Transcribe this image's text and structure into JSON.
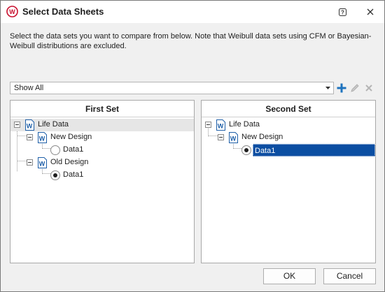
{
  "dialog": {
    "title": "Select Data Sheets",
    "instructions": "Select the data sets you want to compare from below. Note that Weibull data sets using CFM or Bayesian-Weibull distributions are excluded."
  },
  "filter": {
    "selected": "Show All"
  },
  "first_set": {
    "header": "First Set",
    "root": "Life Data",
    "groups": [
      {
        "name": "New Design",
        "item": "Data1",
        "checked": false
      },
      {
        "name": "Old Design",
        "item": "Data1",
        "checked": true
      }
    ]
  },
  "second_set": {
    "header": "Second Set",
    "root": "Life Data",
    "groups": [
      {
        "name": "New Design",
        "item": "Data1",
        "checked": true,
        "selected": true
      }
    ]
  },
  "buttons": {
    "ok": "OK",
    "cancel": "Cancel"
  },
  "colors": {
    "accent": "#0b4ea2",
    "app_icon": "#c8102e",
    "add_icon": "#1e73be"
  },
  "icons": [
    "app-logo-icon",
    "help-icon",
    "close-icon",
    "dropdown-arrow-icon",
    "add-icon",
    "edit-icon",
    "delete-icon",
    "weibull-folio-icon",
    "radio-icon"
  ]
}
